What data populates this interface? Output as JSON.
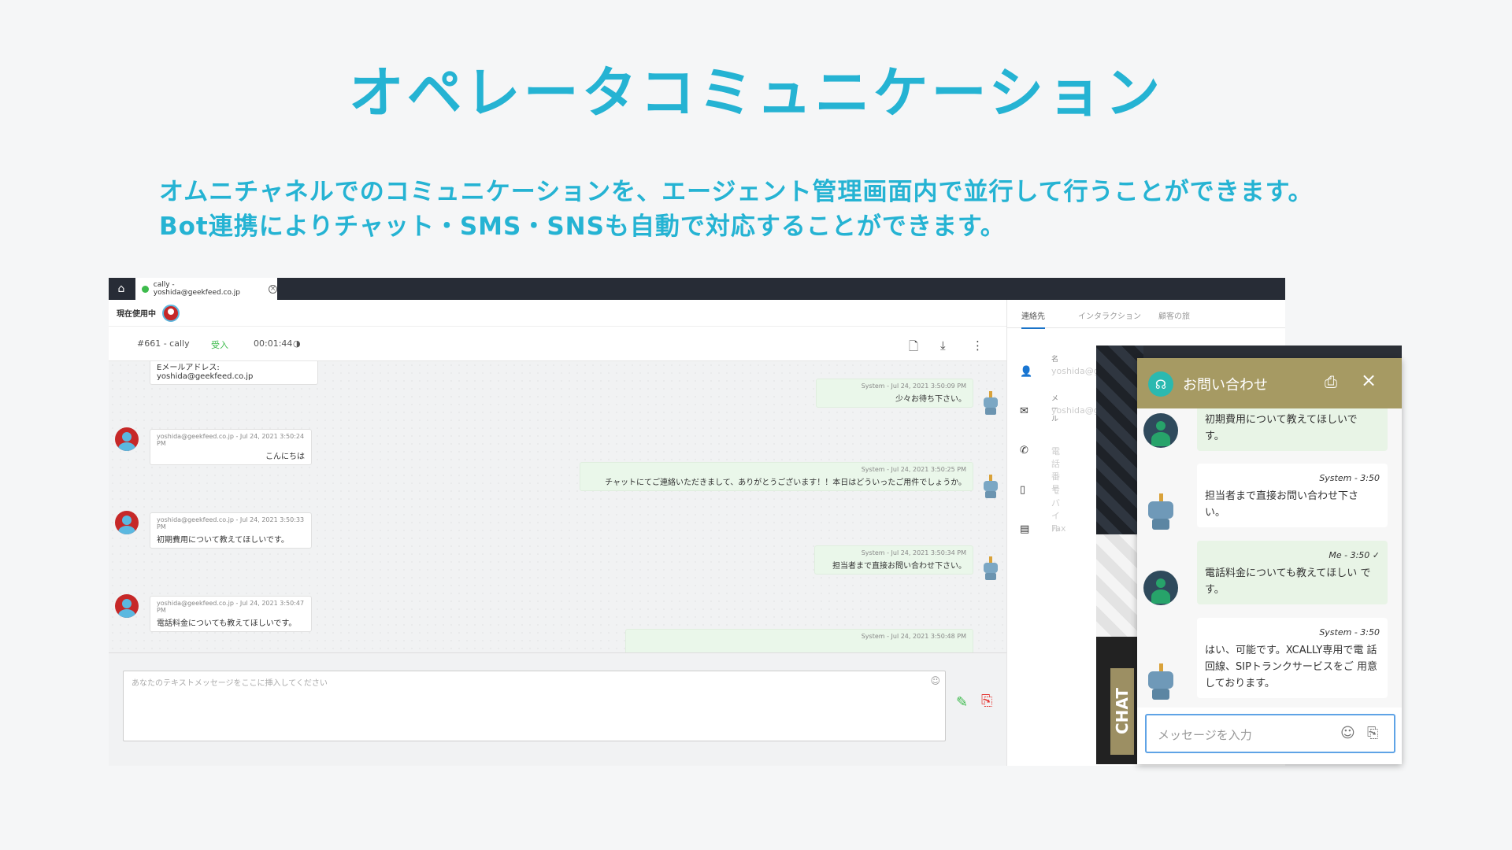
{
  "title": "オペレータコミュニケーション",
  "subtitle": {
    "line1": "オムニチャネルでのコミュニケーションを、エージェント管理画面内で並行して行うことができます。",
    "line2": "Bot連携によりチャット・SMS・SNSも自動で対応することができます。"
  },
  "app": {
    "tab_label": "cally - yoshida@geekfeed.co.jp",
    "status_label": "現在使用中",
    "conversation": {
      "id": "#661 - cally",
      "direction": "受入",
      "timer": "00:01:44"
    },
    "messages": [
      {
        "text": "Eメールアドレス: yoshida@geekfeed.co.jp",
        "meta": ""
      },
      {
        "meta": "System    - Jul 24, 2021 3:50:09 PM",
        "text": "少々お待ち下さい。"
      },
      {
        "meta": "yoshida@geekfeed.co.jp - Jul 24, 2021 3:50:24 PM",
        "text": "こんにちは"
      },
      {
        "meta": "System    - Jul 24, 2021 3:50:25 PM",
        "text": "チャットにてご連絡いただきまして、ありがとうございます！！本日はどういったご用件でしょうか。"
      },
      {
        "meta": "yoshida@geekfeed.co.jp - Jul 24, 2021 3:50:33 PM",
        "text": "初期費用について教えてほしいです。"
      },
      {
        "meta": "System    - Jul 24, 2021 3:50:34 PM",
        "text": "担当者まで直接お問い合わせ下さい。"
      },
      {
        "meta": "yoshida@geekfeed.co.jp - Jul 24, 2021 3:50:47 PM",
        "text": "電話料金についても教えてほしいです。"
      },
      {
        "meta": "System    - Jul 24, 2021 3:50:48 PM",
        "text": ""
      }
    ],
    "input_placeholder": "あなたのテキストメッセージをここに挿入してください",
    "right_tabs": [
      "連絡先",
      "インタラクション",
      "顧客の旅"
    ],
    "contact": {
      "name_label": "名",
      "name_value": "yoshida@g",
      "email_label": "メール",
      "email_value": "yoshida@g",
      "phone_label": "電話番号",
      "mobile_label": "モバイル",
      "fax_label": "Fax"
    }
  },
  "widget": {
    "title": "お問い合わせ",
    "side_tab": "CHAT",
    "messages": [
      {
        "meta": "",
        "text": "初期費用について教えてほしいで す。"
      },
      {
        "meta": "System - 3:50",
        "text": "担当者まで直接お問い合わせ下さ い。"
      },
      {
        "meta": "Me - 3:50 ✓",
        "text": "電話料金についても教えてほしい です。"
      },
      {
        "meta": "System - 3:50",
        "text": "はい、可能です。XCALLY専用で電 話回線、SIPトランクサービスをご 用意しております。"
      }
    ],
    "input_placeholder": "メッセージを入力"
  }
}
